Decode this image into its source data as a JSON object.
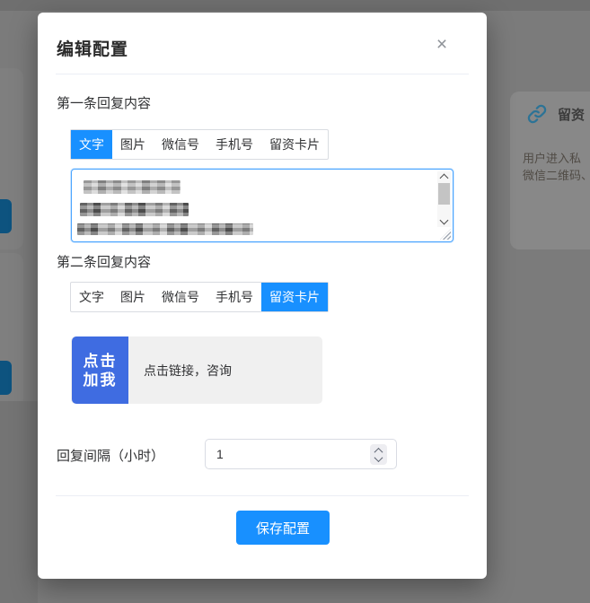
{
  "modal": {
    "title": "编辑配置",
    "close_label": "×",
    "sections": [
      {
        "label": "第一条回复内容",
        "tabs": [
          "文字",
          "图片",
          "微信号",
          "手机号",
          "留资卡片"
        ],
        "active_tab": "文字"
      },
      {
        "label": "第二条回复内容",
        "tabs": [
          "文字",
          "图片",
          "微信号",
          "手机号",
          "留资卡片"
        ],
        "active_tab": "留资卡片"
      }
    ],
    "lead_card": {
      "badge": [
        "点击",
        "加我"
      ],
      "text": "点击链接，咨询"
    },
    "interval_label": "回复间隔（小时）",
    "interval_value": "1",
    "save_label": "保存配置"
  },
  "background": {
    "panel_title": "留资",
    "panel_lines": [
      "用户进入私",
      "微信二维码、"
    ]
  },
  "colors": {
    "accent_blue": "#1890ff",
    "badge_blue": "#3f6ce1",
    "textarea_focus_border": "#4aa5ff",
    "overlay_gray": "#7b7b7b"
  }
}
